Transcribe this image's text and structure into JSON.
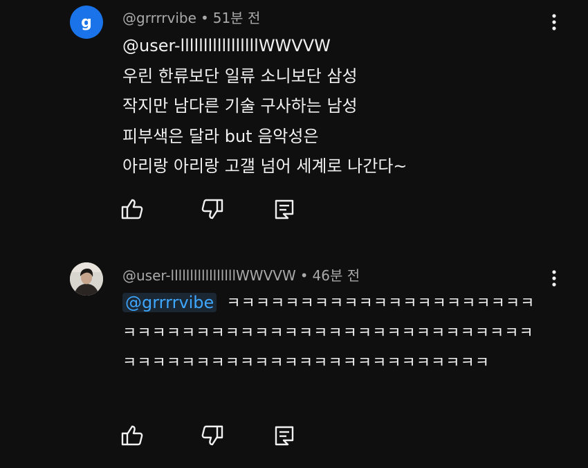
{
  "comments": [
    {
      "avatar_letter": "g",
      "avatar_color": "#1a73e8",
      "author": "@grrrrvibe",
      "separator": "•",
      "time": "51분 전",
      "lines": [
        "@user-lllllllllllllllllWWVVW",
        "우린 한류보단 일류 소니보단 삼성",
        "작지만 남다른 기술 구사하는 남성",
        "피부색은 달라 but 음악성은",
        "아리랑 아리랑 고갤 넘어 세계로 나간다~"
      ],
      "icons": {
        "more": "more-vert-icon",
        "like": "thumb-up-icon",
        "dislike": "thumb-down-icon",
        "reply": "reply-comment-icon"
      }
    },
    {
      "avatar": "user-photo-avatar",
      "author": "@user-lllllllllllllllllWWVVW",
      "separator": "•",
      "time": "46분 전",
      "mention": "@grrrrvibe",
      "text": "ㅋㅋㅋㅋㅋㅋㅋㅋㅋㅋㅋㅋㅋㅋㅋㅋㅋㅋㅋㅋㅋㅋㅋㅋㅋㅋㅋㅋㅋㅋㅋㅋㅋㅋㅋㅋㅋㅋㅋㅋㅋㅋㅋㅋㅋㅋㅋㅋㅋㅋㅋㅋㅋㅋㅋㅋㅋㅋㅋㅋㅋㅋㅋㅋㅋㅋㅋㅋㅋㅋㅋㅋㅋㅋ",
      "icons": {
        "more": "more-vert-icon",
        "like": "thumb-up-icon",
        "dislike": "thumb-down-icon",
        "reply": "reply-comment-icon"
      }
    }
  ],
  "colors": {
    "background": "#0f0f0f",
    "text": "#f1f1f1",
    "meta": "#aaaaaa",
    "mention": "#3ea6ff"
  }
}
